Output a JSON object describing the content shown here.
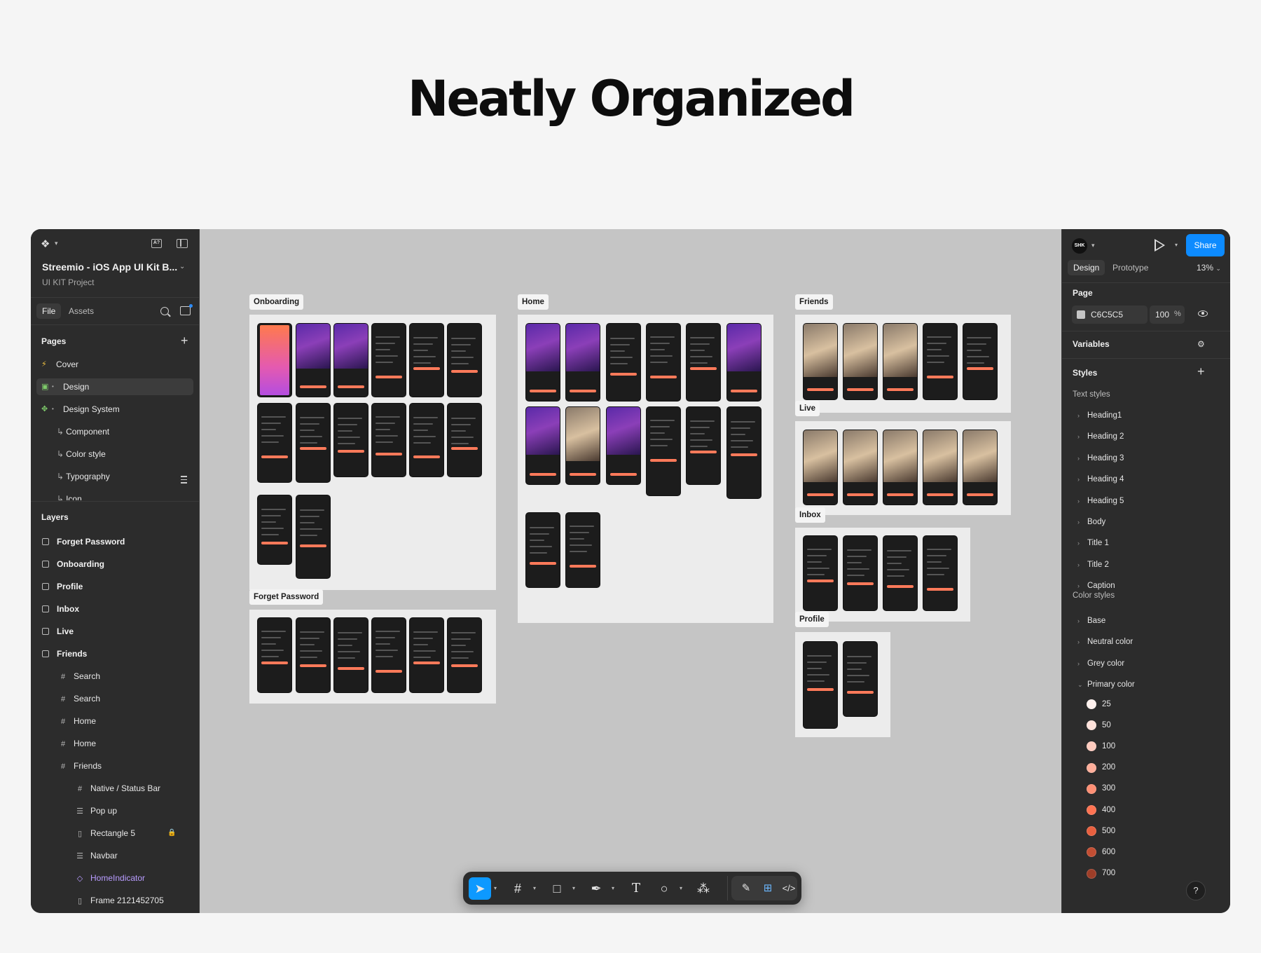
{
  "hero_title": "Neatly Organized",
  "left_panel": {
    "project_title": "Streemio - iOS App UI Kit B...",
    "project_subtitle": "UI KIT Project",
    "tab_file": "File",
    "tab_assets": "Assets",
    "pages_title": "Pages",
    "pages": [
      {
        "label": "Cover",
        "icon": "bolt-icon"
      },
      {
        "label": "Design",
        "icon": "image-icon"
      },
      {
        "label": "Design System",
        "icon": "puzzle-icon"
      },
      {
        "label": "Component",
        "icon": "sub-arrow"
      },
      {
        "label": "Color style",
        "icon": "sub-arrow"
      },
      {
        "label": "Typography",
        "icon": "sub-arrow"
      },
      {
        "label": "Icon",
        "icon": "sub-arrow"
      }
    ],
    "layers_title": "Layers",
    "layers": [
      {
        "label": "Forget Password"
      },
      {
        "label": "Onboarding"
      },
      {
        "label": "Profile"
      },
      {
        "label": "Inbox"
      },
      {
        "label": "Live"
      },
      {
        "label": "Friends"
      },
      {
        "label": "Search"
      },
      {
        "label": "Search"
      },
      {
        "label": "Home"
      },
      {
        "label": "Home"
      },
      {
        "label": "Friends"
      },
      {
        "label": "Native / Status Bar"
      },
      {
        "label": "Pop up"
      },
      {
        "label": "Rectangle 5"
      },
      {
        "label": "Navbar"
      },
      {
        "label": "HomeIndicator"
      },
      {
        "label": "Frame 2121452705"
      }
    ]
  },
  "canvas": {
    "background": "#C5C5C5",
    "frames": [
      {
        "label": "Onboarding"
      },
      {
        "label": "Forget Password"
      },
      {
        "label": "Home"
      },
      {
        "label": "Friends"
      },
      {
        "label": "Live"
      },
      {
        "label": "Inbox"
      },
      {
        "label": "Profile"
      }
    ]
  },
  "toolbar": {
    "tools": [
      "move-tool",
      "frame-tool",
      "shape-tool",
      "pen-tool",
      "text-tool",
      "comment-tool",
      "actions-tool",
      "draw-tool",
      "dev-mode-tool",
      "code-tool"
    ]
  },
  "right_panel": {
    "avatar_initials": "SHK",
    "share_label": "Share",
    "tab_design": "Design",
    "tab_prototype": "Prototype",
    "zoom": "13%",
    "page_title": "Page",
    "page_color": "C6C5C5",
    "page_opacity": "100",
    "opacity_unit": "%",
    "variables_title": "Variables",
    "styles_title": "Styles",
    "text_styles_title": "Text styles",
    "text_styles": [
      "Heading1",
      "Heading 2",
      "Heading 3",
      "Heading 4",
      "Heading 5",
      "Body",
      "Title 1",
      "Title 2",
      "Caption"
    ],
    "color_styles_title": "Color styles",
    "color_groups": [
      "Base",
      "Neutral color",
      "Grey color",
      "Primary color"
    ],
    "primary_colors": [
      {
        "label": "25",
        "color": "#FFF1EE"
      },
      {
        "label": "50",
        "color": "#FFE2DB"
      },
      {
        "label": "100",
        "color": "#FFCBBE"
      },
      {
        "label": "200",
        "color": "#FFAE9A"
      },
      {
        "label": "300",
        "color": "#FF8F74"
      },
      {
        "label": "400",
        "color": "#FF7352"
      },
      {
        "label": "500",
        "color": "#E8603F"
      },
      {
        "label": "600",
        "color": "#C24E33"
      },
      {
        "label": "700",
        "color": "#9E3E28"
      }
    ],
    "accent": "#0D99FF"
  }
}
